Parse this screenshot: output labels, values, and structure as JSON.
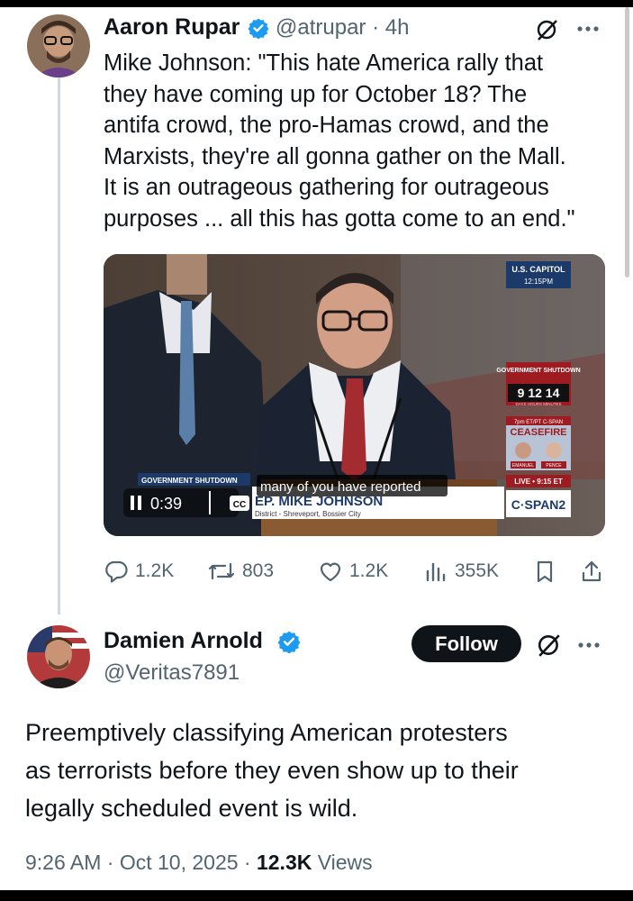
{
  "tweet": {
    "author_name": "Aaron Rupar",
    "handle_time": "@atrupar · 4h",
    "text_lines": [
      "Mike Johnson: \"This hate America rally that",
      "they have coming up for October 18? The",
      "antifa crowd, the pro-Hamas crowd, and the",
      "Marxists, they're all gonna gather on the Mall.",
      "It is an outrageous gathering for outrageous",
      "purposes ... all this has gotta come to an end.\""
    ],
    "video": {
      "time": "0:39",
      "cc_label": "CC",
      "caption": "many of you have reported",
      "lower_third_label": "GOVERNMENT SHUTDOWN",
      "lower_third_name": "EP. MIKE JOHNSON",
      "lower_third_sub": "District - Shreveport, Bossier City",
      "bug_top": "U.S. CAPITOL",
      "bug_time": "12:15PM",
      "shutdown_label": "GOVERNMENT SHUTDOWN",
      "shutdown_count": "9 12 14",
      "shutdown_units": "DAYS  HOURS  MINUTES",
      "promo_top": "7pm ET/PT C-SPAN",
      "promo_title": "CEASEFIRE",
      "promo_left": "EMANUEL",
      "promo_right": "PENCE",
      "live_label": "LIVE • 9:15 ET",
      "network": "C·SPAN2"
    },
    "stats": {
      "replies": "1.2K",
      "reposts": "803",
      "likes": "1.2K",
      "views": "355K"
    }
  },
  "reply": {
    "author_name": "Damien Arnold",
    "handle": "@Veritas7891",
    "follow_label": "Follow",
    "text_lines": [
      "Preemptively classifying American protesters",
      "as terrorists before they even show up to their",
      "legally scheduled event is wild."
    ],
    "time": "9:26 AM · Oct 10, 2025 · ",
    "views_count": "12.3K",
    "views_label": " Views"
  },
  "colors": {
    "verified": "#1d9bf0",
    "text": "#0f1419",
    "secondary": "#536471"
  }
}
